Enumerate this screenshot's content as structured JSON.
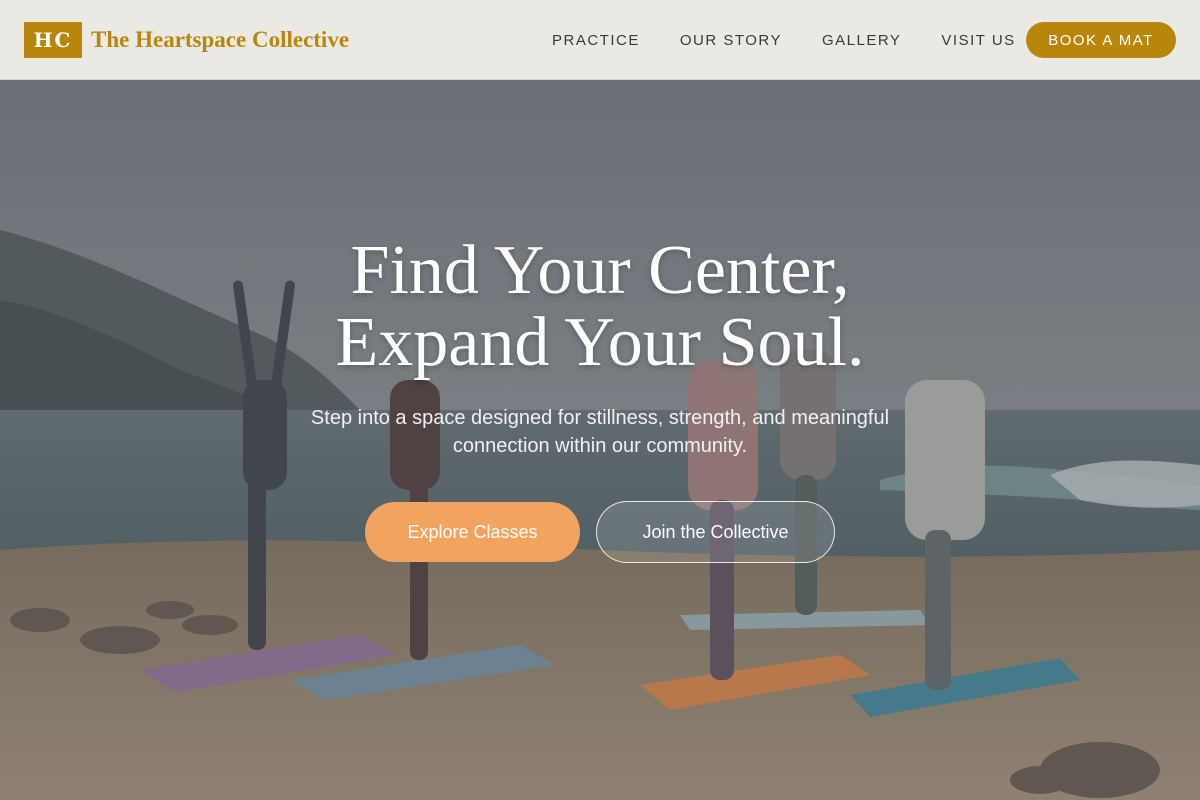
{
  "brand": {
    "logo_initials": "HC",
    "name": "The Heartspace Collective"
  },
  "nav": {
    "links": [
      {
        "label": "PRACTICE"
      },
      {
        "label": "OUR STORY"
      },
      {
        "label": "GALLERY"
      },
      {
        "label": "VISIT US"
      }
    ],
    "cta_label": "BOOK A MAT"
  },
  "hero": {
    "heading_line1": "Find Your Center,",
    "heading_line2": "Expand Your Soul.",
    "subtitle": "Step into a space designed for stillness, strength, and meaningful connection within our community.",
    "primary_button": "Explore Classes",
    "secondary_button": "Join the Collective",
    "background_image": "beach-yoga-group-photo"
  },
  "colors": {
    "brand_gold": "#b8860b",
    "nav_background": "#ebe9e3",
    "primary_button": "#f2a35e",
    "hero_text": "#ffffff"
  }
}
